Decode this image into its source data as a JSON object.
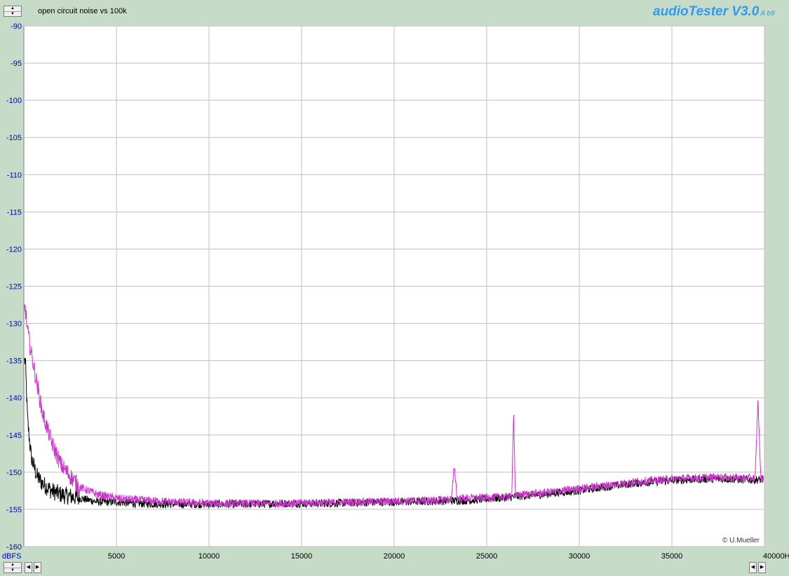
{
  "header": {
    "title": "open circuit noise vs 100k",
    "logo": "audioTester V3.0",
    "logo_sub": "A b9"
  },
  "footer": {
    "credit": "© U.Mueller"
  },
  "icons": {
    "spin_up": "up-arrow-icon",
    "spin_down": "down-arrow-icon",
    "scroll_left": "left-arrow-icon",
    "scroll_right": "right-arrow-icon"
  },
  "colors": {
    "plot_bg": "#ffffff",
    "outer_bg": "#c6dcc8",
    "grid": "#c0c0c0",
    "axis_label": "#0000cc",
    "logo": "#3399ee",
    "series_black": "#000000",
    "series_magenta": "#cc33cc"
  },
  "chart_data": {
    "type": "line",
    "ylabel": "dBFS",
    "xunit": "Hz",
    "xlim": [
      0,
      40000
    ],
    "ylim": [
      -160,
      -90
    ],
    "xticks": [
      5000,
      10000,
      15000,
      20000,
      25000,
      30000,
      35000,
      40000
    ],
    "xtick_labels": [
      "5000",
      "10000",
      "15000",
      "20000",
      "25000",
      "30000",
      "35000",
      "40000Hz"
    ],
    "yticks": [
      -90,
      -95,
      -100,
      -105,
      -110,
      -115,
      -120,
      -125,
      -130,
      -135,
      -140,
      -145,
      -150,
      -155,
      -160
    ],
    "grid": true,
    "series": [
      {
        "color": "#000000",
        "x": [
          80,
          200,
          400,
          700,
          1000,
          1500,
          2000,
          3000,
          4000,
          5000,
          6000,
          8000,
          10000,
          12000,
          14000,
          16000,
          18000,
          20000,
          22000,
          24000,
          25000,
          26000,
          27000,
          28000,
          29000,
          30000,
          31000,
          32000,
          33000,
          34000,
          35000,
          36000,
          37000,
          38000,
          39000,
          40000
        ],
        "y": [
          -135,
          -143,
          -148,
          -150.5,
          -151.5,
          -152.5,
          -153,
          -153.5,
          -154,
          -154,
          -154.2,
          -154.3,
          -154.3,
          -154.3,
          -154.2,
          -154.2,
          -154.1,
          -154,
          -153.9,
          -153.8,
          -153.6,
          -153.4,
          -153.2,
          -153,
          -152.7,
          -152.5,
          -152.1,
          -151.8,
          -151.5,
          -151.3,
          -151.1,
          -151,
          -150.9,
          -150.9,
          -151,
          -151
        ]
      },
      {
        "color": "#cc33cc",
        "x": [
          80,
          200,
          400,
          700,
          1000,
          1500,
          2000,
          3000,
          4000,
          5000,
          6000,
          8000,
          10000,
          12000,
          14000,
          16000,
          18000,
          20000,
          22000,
          23100,
          23250,
          23400,
          24000,
          26350,
          26450,
          26550,
          27000,
          28000,
          29000,
          30000,
          31000,
          32000,
          33000,
          34000,
          35000,
          36000,
          37000,
          38000,
          39000,
          39500,
          39650,
          39800,
          40000
        ],
        "y": [
          -128,
          -131,
          -134,
          -138,
          -142,
          -146,
          -149,
          -152,
          -153,
          -153.5,
          -153.7,
          -154,
          -154.2,
          -154.2,
          -154.2,
          -154.1,
          -154,
          -153.9,
          -153.8,
          -153.6,
          -149,
          -153.5,
          -153.5,
          -153.3,
          -141.5,
          -153.2,
          -153,
          -152.8,
          -152.5,
          -152.2,
          -151.9,
          -151.6,
          -151.3,
          -151.1,
          -150.9,
          -150.8,
          -150.7,
          -150.7,
          -150.8,
          -150.8,
          -140,
          -150.8,
          -151
        ]
      }
    ]
  }
}
